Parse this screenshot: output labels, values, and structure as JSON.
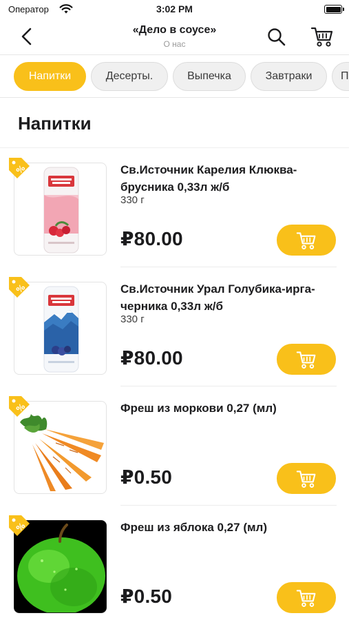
{
  "status_bar": {
    "carrier": "Оператор",
    "time": "3:02 PM"
  },
  "header": {
    "title": "«Дело в соусе»",
    "subtitle": "О нас",
    "icons": {
      "back": "chevron-left-icon",
      "search": "search-icon",
      "cart": "cart-icon"
    }
  },
  "tabs": [
    {
      "label": "Напитки",
      "active": true
    },
    {
      "label": "Десерты.",
      "active": false
    },
    {
      "label": "Выпечка",
      "active": false
    },
    {
      "label": "Завтраки",
      "active": false
    },
    {
      "label": "П",
      "active": false
    }
  ],
  "section": {
    "title": "Напитки"
  },
  "products": [
    {
      "name": "Св.Источник Карелия Клюква-брусника 0,33л ж/б",
      "weight": "330 г",
      "price": "₽80.00",
      "image": "can-pink"
    },
    {
      "name": "Св.Источник Урал Голубика-ирга-черника 0,33л ж/б",
      "weight": "330 г",
      "price": "₽80.00",
      "image": "can-blue"
    },
    {
      "name": "Фреш из моркови 0,27 (мл)",
      "weight": "",
      "price": "₽0.50",
      "image": "carrots"
    },
    {
      "name": "Фреш из яблока 0,27 (мл)",
      "weight": "",
      "price": "₽0.50",
      "image": "green-apple"
    }
  ],
  "colors": {
    "accent": "#f9c01a",
    "tab_inactive_bg": "#f0f0f0",
    "text_primary": "#1c1c1e",
    "text_secondary": "#9a9a9a"
  }
}
